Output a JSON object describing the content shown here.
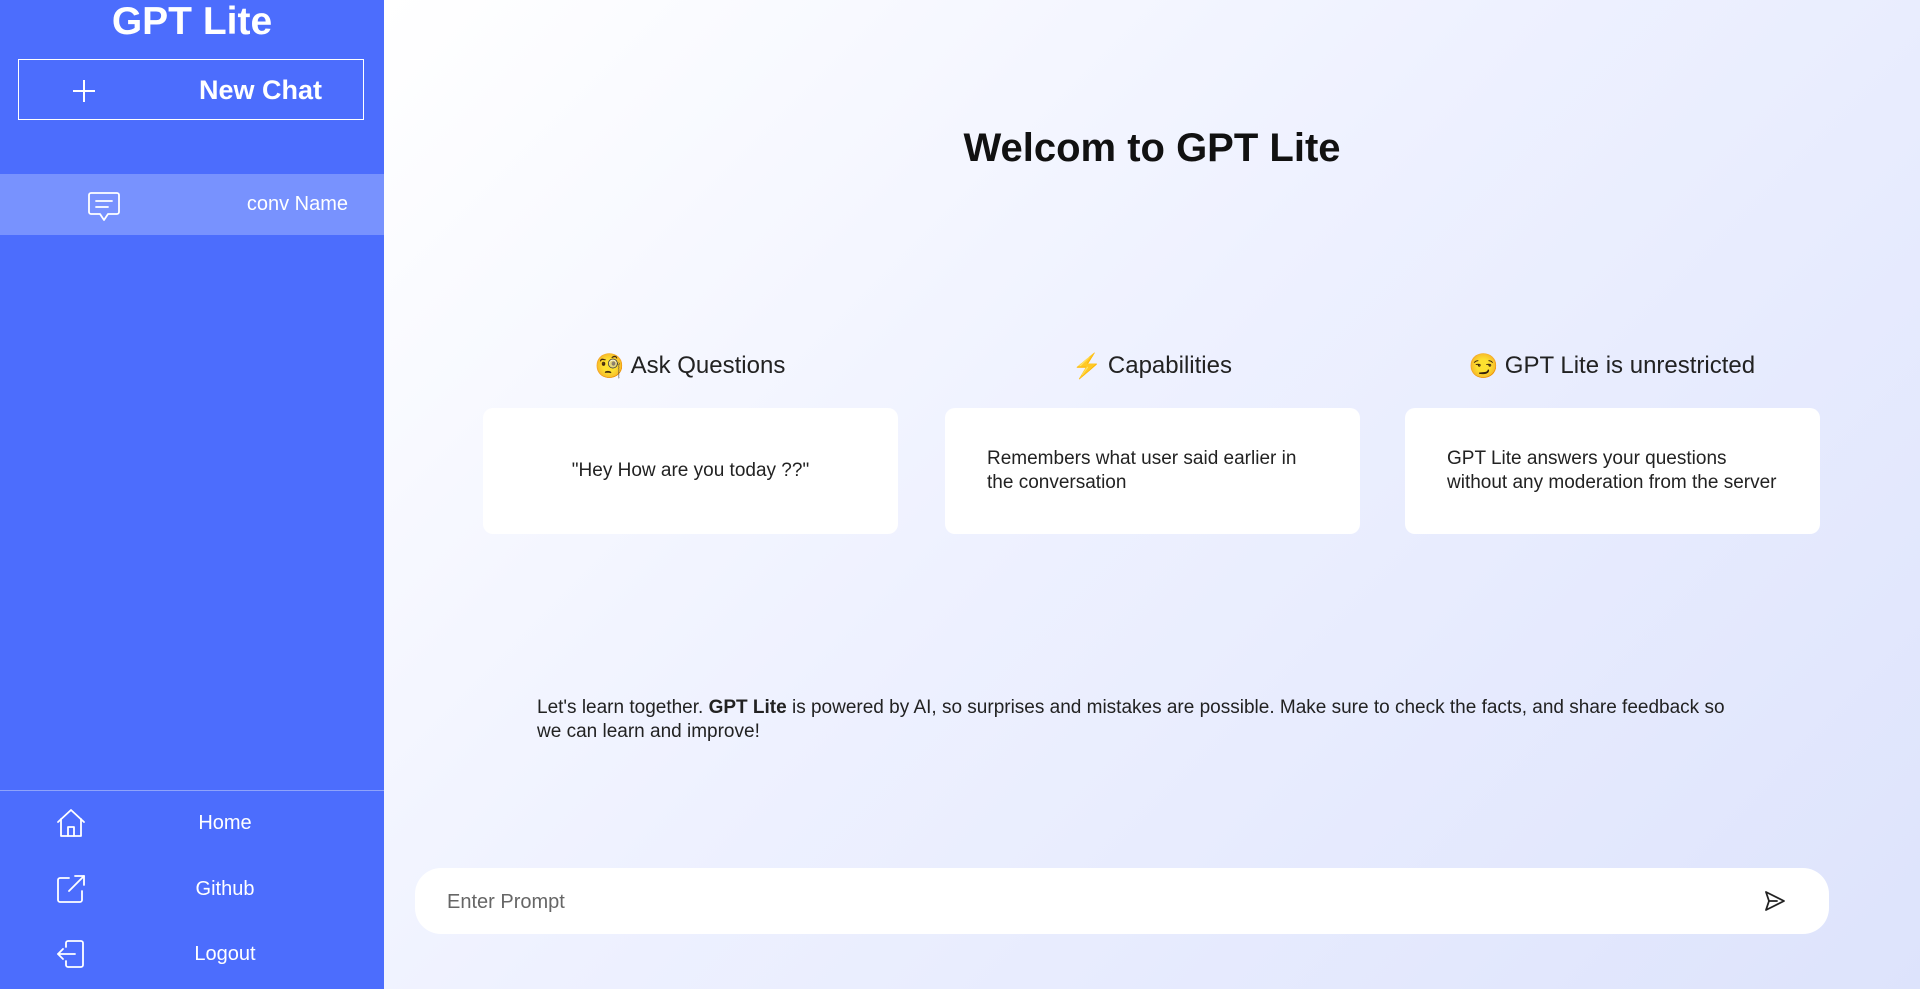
{
  "sidebar": {
    "brand": "GPT Lite",
    "new_chat_label": "New Chat",
    "conversations": [
      {
        "label": "conv Name"
      }
    ],
    "nav": [
      {
        "label": "Home",
        "icon": "home-icon"
      },
      {
        "label": "Github",
        "icon": "external-link-icon"
      },
      {
        "label": "Logout",
        "icon": "logout-icon"
      }
    ]
  },
  "main": {
    "welcome": "Welcom to GPT Lite",
    "features": [
      {
        "emoji": "🧐",
        "heading": "Ask Questions",
        "text": "\"Hey How are you today ??\""
      },
      {
        "emoji": "⚡",
        "heading": "Capabilities",
        "text": "Remembers what user said earlier in the conversation"
      },
      {
        "emoji": "😏",
        "heading": "GPT Lite is unrestricted",
        "text": "GPT Lite answers your questions without any moderation from the server"
      }
    ],
    "disclaimer": {
      "prefix": "Let's learn together. ",
      "bold": "GPT Lite",
      "suffix": " is powered by AI, so surprises and mistakes are possible. Make sure to check the facts, and share feedback so we can learn and improve!"
    },
    "prompt": {
      "placeholder": "Enter Prompt",
      "value": ""
    }
  },
  "colors": {
    "sidebar": "#4c6dfd",
    "active_item": "#7892fe",
    "card": "#ffffff"
  }
}
